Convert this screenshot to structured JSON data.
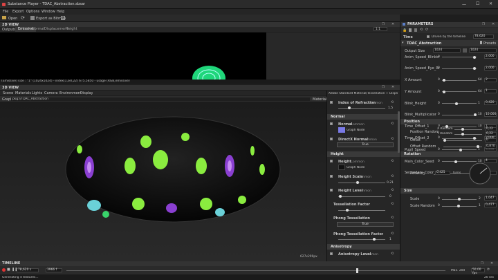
{
  "app": {
    "title": "Substance Player - TDAC_Abstraction.sbsar",
    "menu": [
      "File",
      "Export",
      "Options",
      "Window",
      "Help"
    ],
    "toolbar": {
      "open_label": "Open",
      "export_label": "Export as Bitmap"
    }
  },
  "view2d": {
    "title": "2D VIEW",
    "outputs_label": "Outputs:",
    "tabs": [
      "Emissive",
      "Normal",
      "Displacement",
      "Height"
    ],
    "active_tab": "Emissive",
    "zoom": "1:1",
    "status": "(Emissive) size : \"1\" (1024x1024) - index(1,sel,22) 675.5850 - usage (RGB,emissive)"
  },
  "view3d": {
    "title": "3D VIEW",
    "tabs": [
      "Scene",
      "Materials",
      "Lights",
      "Camera",
      "Environment",
      "Display"
    ],
    "graph_label": "Graph:",
    "graph_value": "pkg://TDAC_Abstraction",
    "materials_label": "Materials",
    "resolution": "627x299px",
    "shader_title": "Adobe Standard Material/Tessellation + Displacement"
  },
  "material": {
    "ior": {
      "label": "Index of Refraction",
      "badge": "Common",
      "value": "1.5"
    },
    "normal_section": "Normal",
    "normal": {
      "label": "Normal",
      "badge": "Common",
      "node": "Graph Node"
    },
    "directx": {
      "label": "DirectX Normal",
      "badge": "Common",
      "value": "True"
    },
    "height_section": "Height",
    "height": {
      "label": "Height",
      "badge": "Common",
      "node": "Graph Node"
    },
    "height_scale": {
      "label": "Height Scale",
      "badge": "Common",
      "value": "0.21"
    },
    "height_level": {
      "label": "Height Level",
      "badge": "Common",
      "value": "0"
    },
    "tess_factor": {
      "label": "Tessellation Factor",
      "value": ""
    },
    "phong_tess": {
      "label": "Phong Tessellation",
      "value": "True"
    },
    "phong_tess_factor": {
      "label": "Phong Tessellation Factor",
      "value": "1"
    },
    "anisotropy_section": "Anisotropy",
    "aniso_level": {
      "label": "Anisotropy Level",
      "badge": "Common"
    }
  },
  "parameters": {
    "title": "PARAMETERS",
    "time_label": "Time",
    "driven_label": "Driven by the timeline",
    "time_value": "78,620",
    "graph_name": "TDAC_Abstraction",
    "presets_label": "Presets",
    "output_size_label": "Output Size",
    "output_size_a": "1024",
    "output_size_b": "1024",
    "rows": [
      {
        "label": "Anim_Speed_Blinking",
        "value": "2,000",
        "min": "0",
        "max": "",
        "frac": 0.98
      },
      {
        "label": "Anim_Speed_Eye_Roll",
        "value": "2,000",
        "min": "0",
        "max": "",
        "frac": 0.98
      },
      {
        "label": "X Amount",
        "value": "2",
        "min": "0",
        "max": "64",
        "frac": 0.03
      },
      {
        "label": "Y Amount",
        "value": "1",
        "min": "0",
        "max": "64",
        "frac": 0.02
      },
      {
        "label": "Blink_Height",
        "value": "0,420",
        "min": "0",
        "max": "1",
        "frac": 0.42
      },
      {
        "label": "Blink_Multiplicator",
        "value": "10,000",
        "min": "0",
        "max": "10",
        "frac": 0.99
      },
      {
        "label": "Time_Offset_1",
        "value": "1",
        "min": "0",
        "max": "10",
        "frac": 0.1
      },
      {
        "label": "Time_Offset_2",
        "value": "2,000",
        "min": "0",
        "max": "",
        "frac": 0.98
      },
      {
        "label": "Pupil_Speed",
        "value": "0,538",
        "min": "0",
        "max": "1",
        "frac": 0.54
      },
      {
        "label": "Main_Color_Seed",
        "value": "4",
        "min": "0",
        "max": "10",
        "frac": 0.4
      },
      {
        "label": "Secondary_Color_Seed",
        "value": "1",
        "min": "0",
        "max": "10",
        "frac": 0.1
      }
    ],
    "position_section": "Position",
    "position_random_label": "Position Random",
    "x_random_label": "X Random",
    "y_random_label": "Y Random",
    "x_random_value": "0,22",
    "y_random_value": "0,22",
    "offset_label": "Offset",
    "offset_value": "0",
    "offset_random_label": "Offset Random",
    "offset_random_value": "0,870",
    "rotation_section": "Rotation",
    "rotation_label": "Rotation",
    "rotation_value": "0,425",
    "rotation_unit": "turns",
    "size_section": "Size",
    "scale_label": "Scale",
    "scale_value": "1,047",
    "scale_random_label": "Scale Random",
    "scale_random_value": "0,477",
    "size_min": "0",
    "size_max": "2",
    "scale_random_max": "1"
  },
  "timeline": {
    "title": "TIMELINE",
    "current_time": "78,620 s",
    "frame": "3966 f",
    "max_label": "Max. 200",
    "fps": "50,00 fps",
    "end_time": "20 sec",
    "status": "Generating 4 textures..."
  },
  "colors": {
    "accent": "#5a7ec8",
    "panel_bg": "#262626",
    "torus_green": "#7fe54a",
    "torus_purple": "#8a3fd1"
  }
}
